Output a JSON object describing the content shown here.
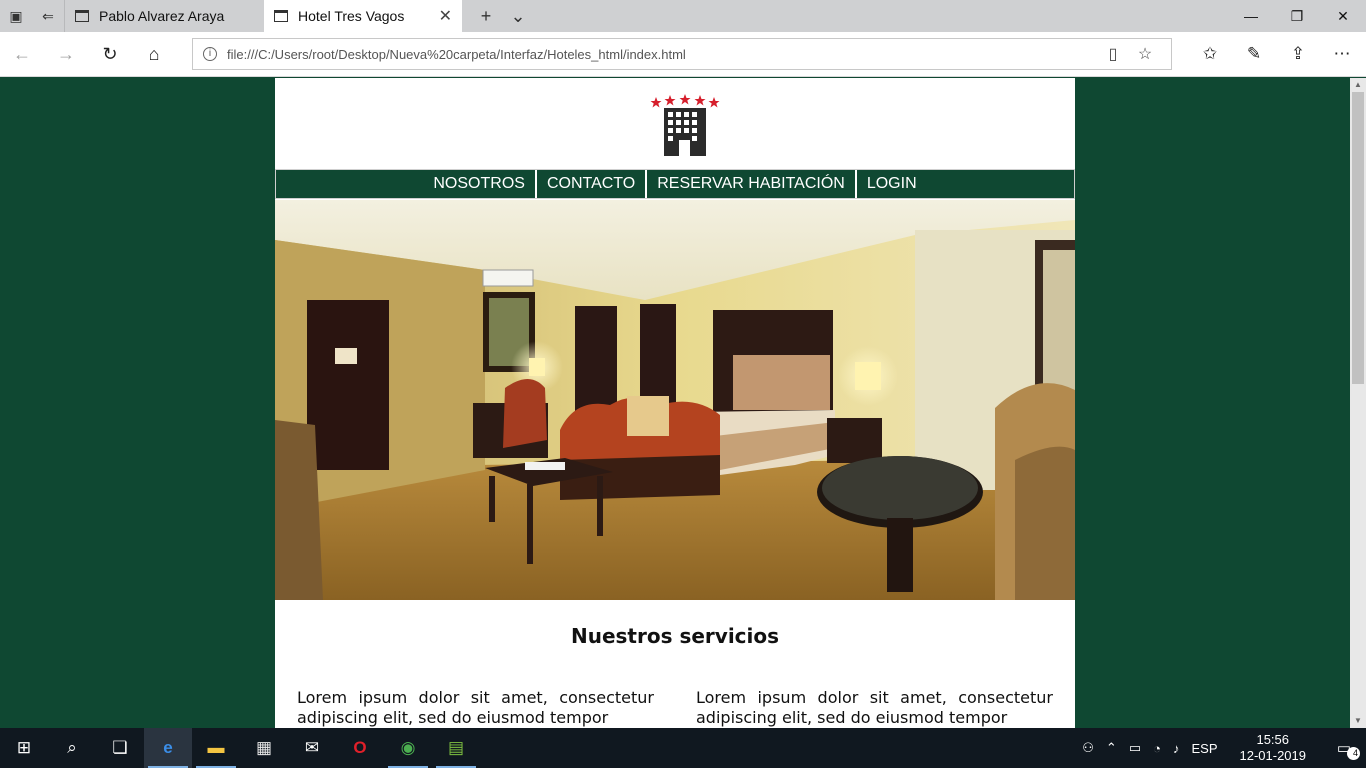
{
  "browser": {
    "tabs": [
      {
        "label": "Pablo Alvarez Araya",
        "active": false
      },
      {
        "label": "Hotel Tres Vagos",
        "active": true
      }
    ],
    "address_url": "file:///C:/Users/root/Desktop/Nueva%20carpeta/Interfaz/Hoteles_html/index.html"
  },
  "site": {
    "menu": [
      "NOSOTROS",
      "CONTACTO",
      "RESERVAR HABITACIÓN",
      "LOGIN"
    ],
    "section_title": "Nuestros servicios",
    "col_left_text": "Lorem ipsum dolor sit amet, consectetur adipiscing elit, sed do eiusmod tempor",
    "col_right_text": "Lorem ipsum dolor sit amet, consectetur adipiscing elit, sed do eiusmod tempor",
    "brand_colors": {
      "primary": "#0f4832",
      "stars": "#d61f2c",
      "building": "#2b2b2b"
    }
  },
  "taskbar": {
    "lang": "ESP",
    "time": "15:56",
    "date": "12-01-2019",
    "notification_count": "4"
  }
}
